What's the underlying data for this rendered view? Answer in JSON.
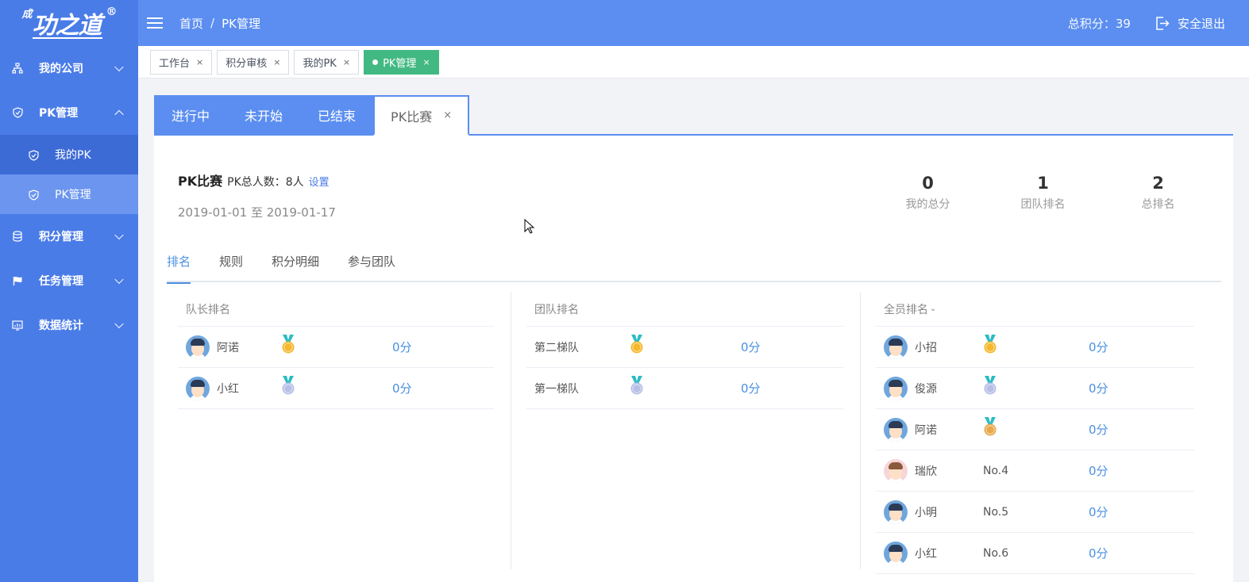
{
  "colors": {
    "sidebar": "#4a7ce8",
    "header": "#5b8ef0",
    "accent_green": "#42b983",
    "link_blue": "#4a90e2",
    "gold": "#f5b82e",
    "silver": "#b7bfe6",
    "bronze": "#e8a94c"
  },
  "logo": {
    "small": "成",
    "main": "功之道",
    "reg": "®"
  },
  "sidebar": {
    "items": [
      {
        "label": "我的公司",
        "icon": "org-chart-icon",
        "expanded": false
      },
      {
        "label": "PK管理",
        "icon": "shield-icon",
        "expanded": true,
        "children": [
          {
            "label": "我的PK",
            "icon": "shield-icon"
          },
          {
            "label": "PK管理",
            "icon": "shield-icon"
          }
        ]
      },
      {
        "label": "积分管理",
        "icon": "database-icon",
        "expanded": false
      },
      {
        "label": "任务管理",
        "icon": "flag-icon",
        "expanded": false
      },
      {
        "label": "数据统计",
        "icon": "chart-icon",
        "expanded": false
      }
    ]
  },
  "header": {
    "breadcrumb": [
      "首页",
      "PK管理"
    ],
    "breadcrumb_sep": "/",
    "score": "总积分：39",
    "logout": "安全退出"
  },
  "tags": [
    {
      "label": "工作台",
      "close": "×"
    },
    {
      "label": "积分审核",
      "close": "×"
    },
    {
      "label": "我的PK",
      "close": "×"
    },
    {
      "label": "PK管理",
      "close": "×",
      "active": true
    }
  ],
  "panel_tabs": [
    {
      "label": "进行中"
    },
    {
      "label": "未开始"
    },
    {
      "label": "已结束"
    },
    {
      "label": "PK比赛",
      "close": "×",
      "active": true
    }
  ],
  "info": {
    "title": "PK比赛",
    "count": "PK总人数：8人",
    "setting_link": "设置",
    "date_range": "2019-01-01 至 2019-01-17"
  },
  "stats": [
    {
      "value": "0",
      "label": "我的总分"
    },
    {
      "value": "1",
      "label": "团队排名"
    },
    {
      "value": "2",
      "label": "总排名"
    }
  ],
  "sub_tabs": [
    "排名",
    "规则",
    "积分明细",
    "参与团队"
  ],
  "captain_ranking": {
    "title": "队长排名",
    "rows": [
      {
        "name": "阿诺",
        "medal": "1",
        "points": "0分"
      },
      {
        "name": "小红",
        "medal": "2",
        "points": "0分"
      }
    ]
  },
  "team_ranking": {
    "title": "团队排名",
    "rows": [
      {
        "name": "第二梯队",
        "medal": "1",
        "points": "0分"
      },
      {
        "name": "第一梯队",
        "medal": "2",
        "points": "0分"
      }
    ]
  },
  "all_ranking": {
    "title": "全员排名",
    "caret": "⌄",
    "rows": [
      {
        "name": "小招",
        "medal": "1",
        "points": "0分"
      },
      {
        "name": "俊源",
        "medal": "2",
        "points": "0分"
      },
      {
        "name": "阿诺",
        "medal": "3",
        "points": "0分"
      },
      {
        "name": "瑞欣",
        "rank": "No.4",
        "points": "0分",
        "avatar": "pink"
      },
      {
        "name": "小明",
        "rank": "No.5",
        "points": "0分"
      },
      {
        "name": "小红",
        "rank": "No.6",
        "points": "0分"
      }
    ]
  }
}
